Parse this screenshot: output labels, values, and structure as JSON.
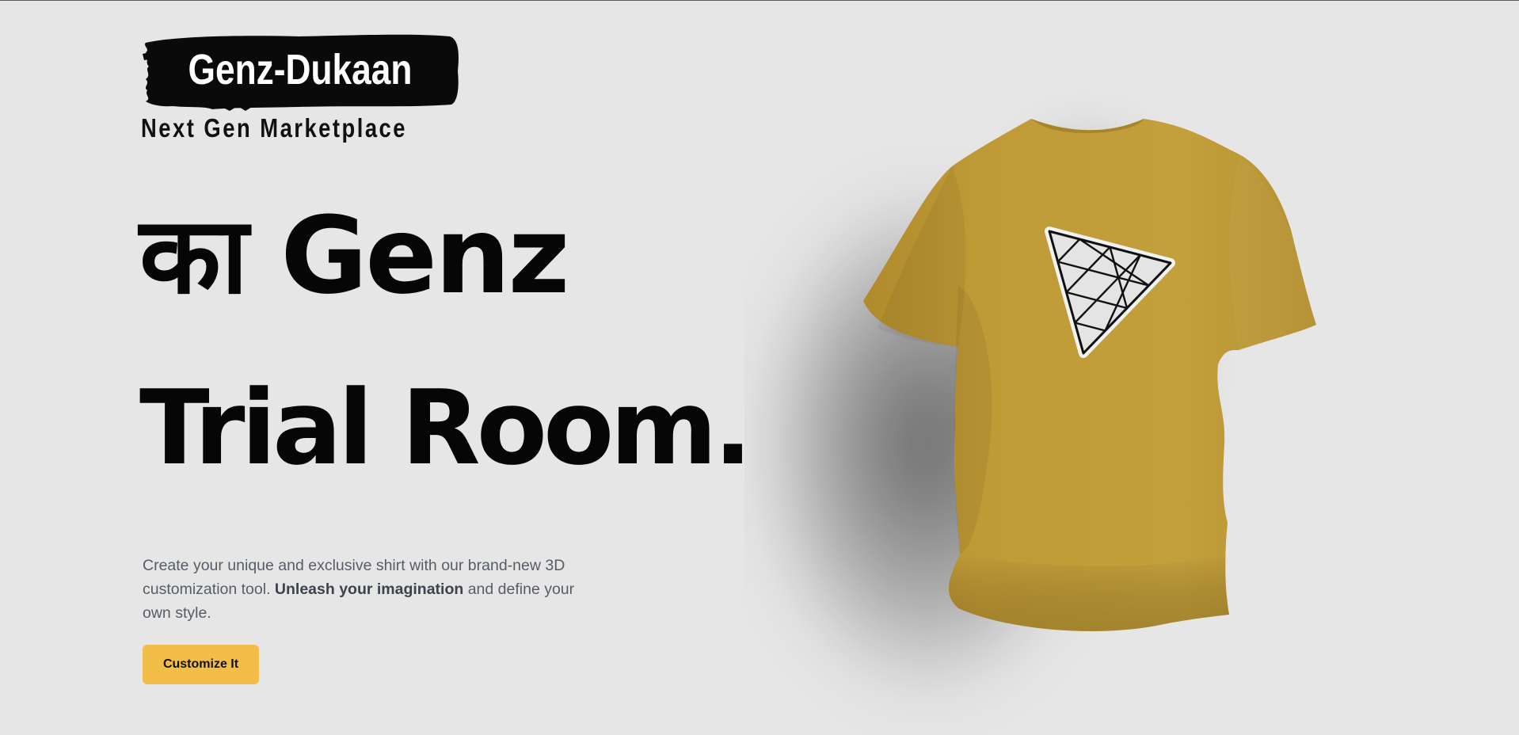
{
  "brand": {
    "name": "Genz-Dukaan",
    "tagline": "Next Gen Marketplace"
  },
  "hero": {
    "headline_line1": "का Genz",
    "headline_line2": "Trial Room.",
    "description_part1": "Create your unique and exclusive shirt with our brand-new 3D customization tool. ",
    "description_bold": "Unleash your imagination",
    "description_part2": " and define your own style.",
    "cta_label": "Customize It"
  },
  "viewer": {
    "shirt_color": "#c09a37",
    "decal_icon": "triangle-grid-logo-icon"
  },
  "colors": {
    "background": "#e6e6e6",
    "accent": "#f2be47",
    "text_primary": "#060606",
    "text_muted": "#575d66"
  }
}
